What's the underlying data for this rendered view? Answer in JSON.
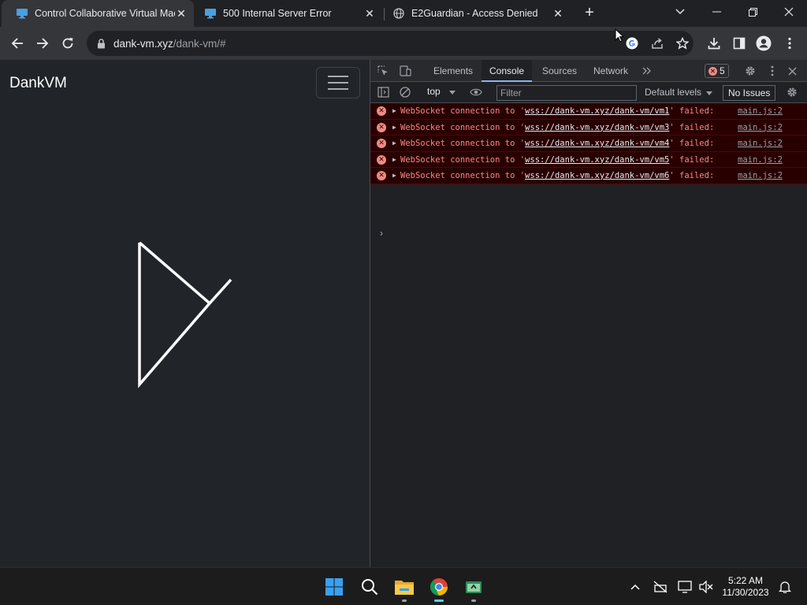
{
  "browser": {
    "tabs": [
      {
        "title": "Control Collaborative Virtual Mac",
        "active": true,
        "favicon": "monitor-icon"
      },
      {
        "title": "500 Internal Server Error",
        "active": false,
        "favicon": "monitor-icon"
      },
      {
        "title": "E2Guardian - Access Denied",
        "active": false,
        "favicon": "globe-icon"
      }
    ],
    "close_glyph": "✕",
    "new_tab_glyph": "+",
    "url_host": "dank-vm.xyz",
    "url_path": "/dank-vm/#"
  },
  "page": {
    "brand": "DankVM"
  },
  "devtools": {
    "tabs": [
      "Elements",
      "Console",
      "Sources",
      "Network"
    ],
    "active_tab": "Console",
    "error_count": "5",
    "context": "top",
    "filter_placeholder": "Filter",
    "levels": "Default levels",
    "issues": "No Issues",
    "logs": [
      {
        "prefix": "WebSocket connection to '",
        "url": "wss://dank-vm.xyz/dank-vm/vm1",
        "suffix": "' failed:",
        "source": "main.js:2"
      },
      {
        "prefix": "WebSocket connection to '",
        "url": "wss://dank-vm.xyz/dank-vm/vm3",
        "suffix": "' failed:",
        "source": "main.js:2"
      },
      {
        "prefix": "WebSocket connection to '",
        "url": "wss://dank-vm.xyz/dank-vm/vm4",
        "suffix": "' failed:",
        "source": "main.js:2"
      },
      {
        "prefix": "WebSocket connection to '",
        "url": "wss://dank-vm.xyz/dank-vm/vm5",
        "suffix": "' failed:",
        "source": "main.js:2"
      },
      {
        "prefix": "WebSocket connection to '",
        "url": "wss://dank-vm.xyz/dank-vm/vm6",
        "suffix": "' failed:",
        "source": "main.js:2"
      }
    ],
    "prompt_glyph": "›"
  },
  "taskbar": {
    "time": "5:22 AM",
    "date": "11/30/2023"
  },
  "colors": {
    "error_text": "#f28b82",
    "error_bg": "#290000",
    "accent": "#8ab4f8"
  }
}
